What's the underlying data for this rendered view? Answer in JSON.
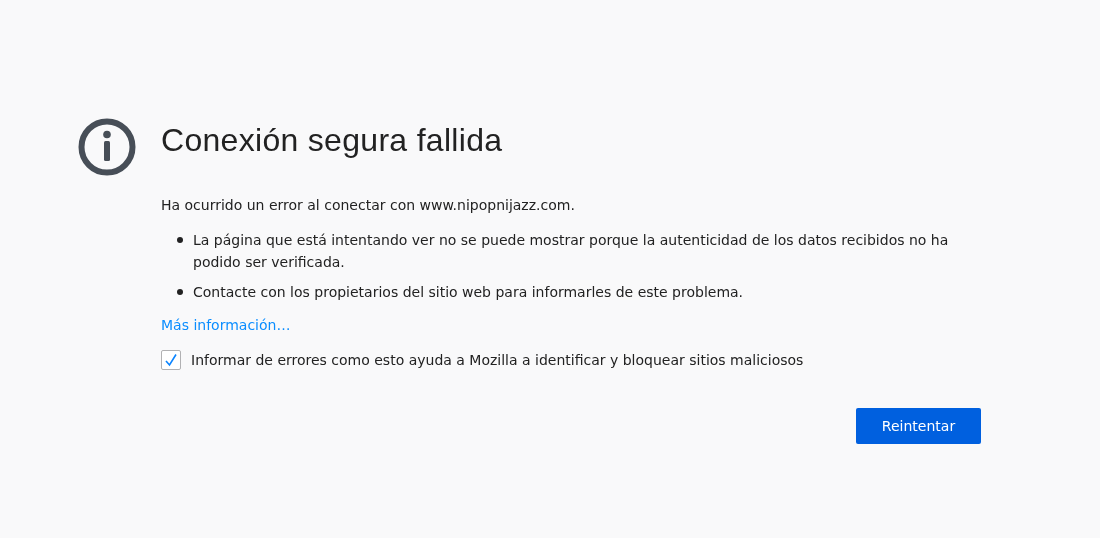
{
  "title": "Conexión segura fallida",
  "intro": "Ha ocurrido un error al conectar con www.nipopnijazz.com.",
  "bullets": [
    "La página que está intentando ver no se puede mostrar porque la autenticidad de los datos recibidos no ha podido ser verificada.",
    "Contacte con los propietarios del sitio web para informarles de este problema."
  ],
  "more_link": "Más información…",
  "report": {
    "label": "Informar de errores como esto ayuda a Mozilla a identificar y bloquear sitios maliciosos",
    "checked": true
  },
  "button": "Reintentar"
}
